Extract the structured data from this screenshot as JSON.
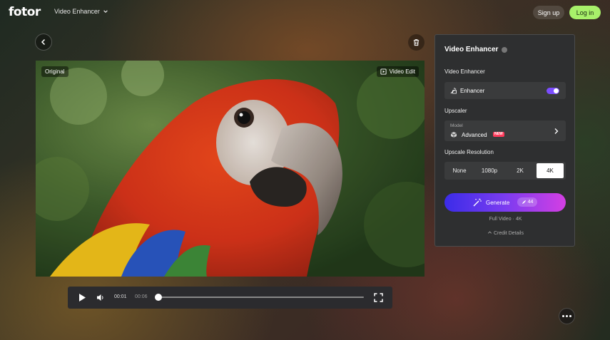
{
  "header": {
    "logo": "fotor",
    "tool_menu": "Video Enhancer",
    "signup": "Sign up",
    "login": "Log in"
  },
  "preview": {
    "tag_original": "Original",
    "tag_edit": "Video Edit"
  },
  "player": {
    "current_time": "00:01",
    "total_time": "00:06",
    "progress_fraction": 0.0
  },
  "panel": {
    "title": "Video Enhancer",
    "enhancer_section": "Video Enhancer",
    "enhancer_label": "Enhancer",
    "enhancer_on": true,
    "upscaler_section": "Upscaler",
    "model_caption": "Model",
    "model_value": "Advanced",
    "model_badge": "NEW",
    "resolution_section": "Upscale Resolution",
    "resolutions": [
      "None",
      "1080p",
      "2K",
      "4K"
    ],
    "selected_resolution": "4K",
    "generate_label": "Generate",
    "credits": "44",
    "full_video": "Full Video · 4K",
    "credit_details": "Credit Details"
  },
  "colors": {
    "accent_green": "#a8f06a",
    "toggle_purple": "#7b4dff",
    "gradient_start": "#3b2ce8",
    "gradient_end": "#d43fe3",
    "new_badge": "#ff3b5c"
  },
  "icons": [
    "chevron-down-icon",
    "arrow-left-icon",
    "trash-icon",
    "video-edit-icon",
    "play-icon",
    "volume-icon",
    "fullscreen-icon",
    "enhancer-icon",
    "cube-icon",
    "chevron-right-icon",
    "magic-wand-icon",
    "feather-credit-icon",
    "chevron-up-icon",
    "more-dots-icon"
  ]
}
